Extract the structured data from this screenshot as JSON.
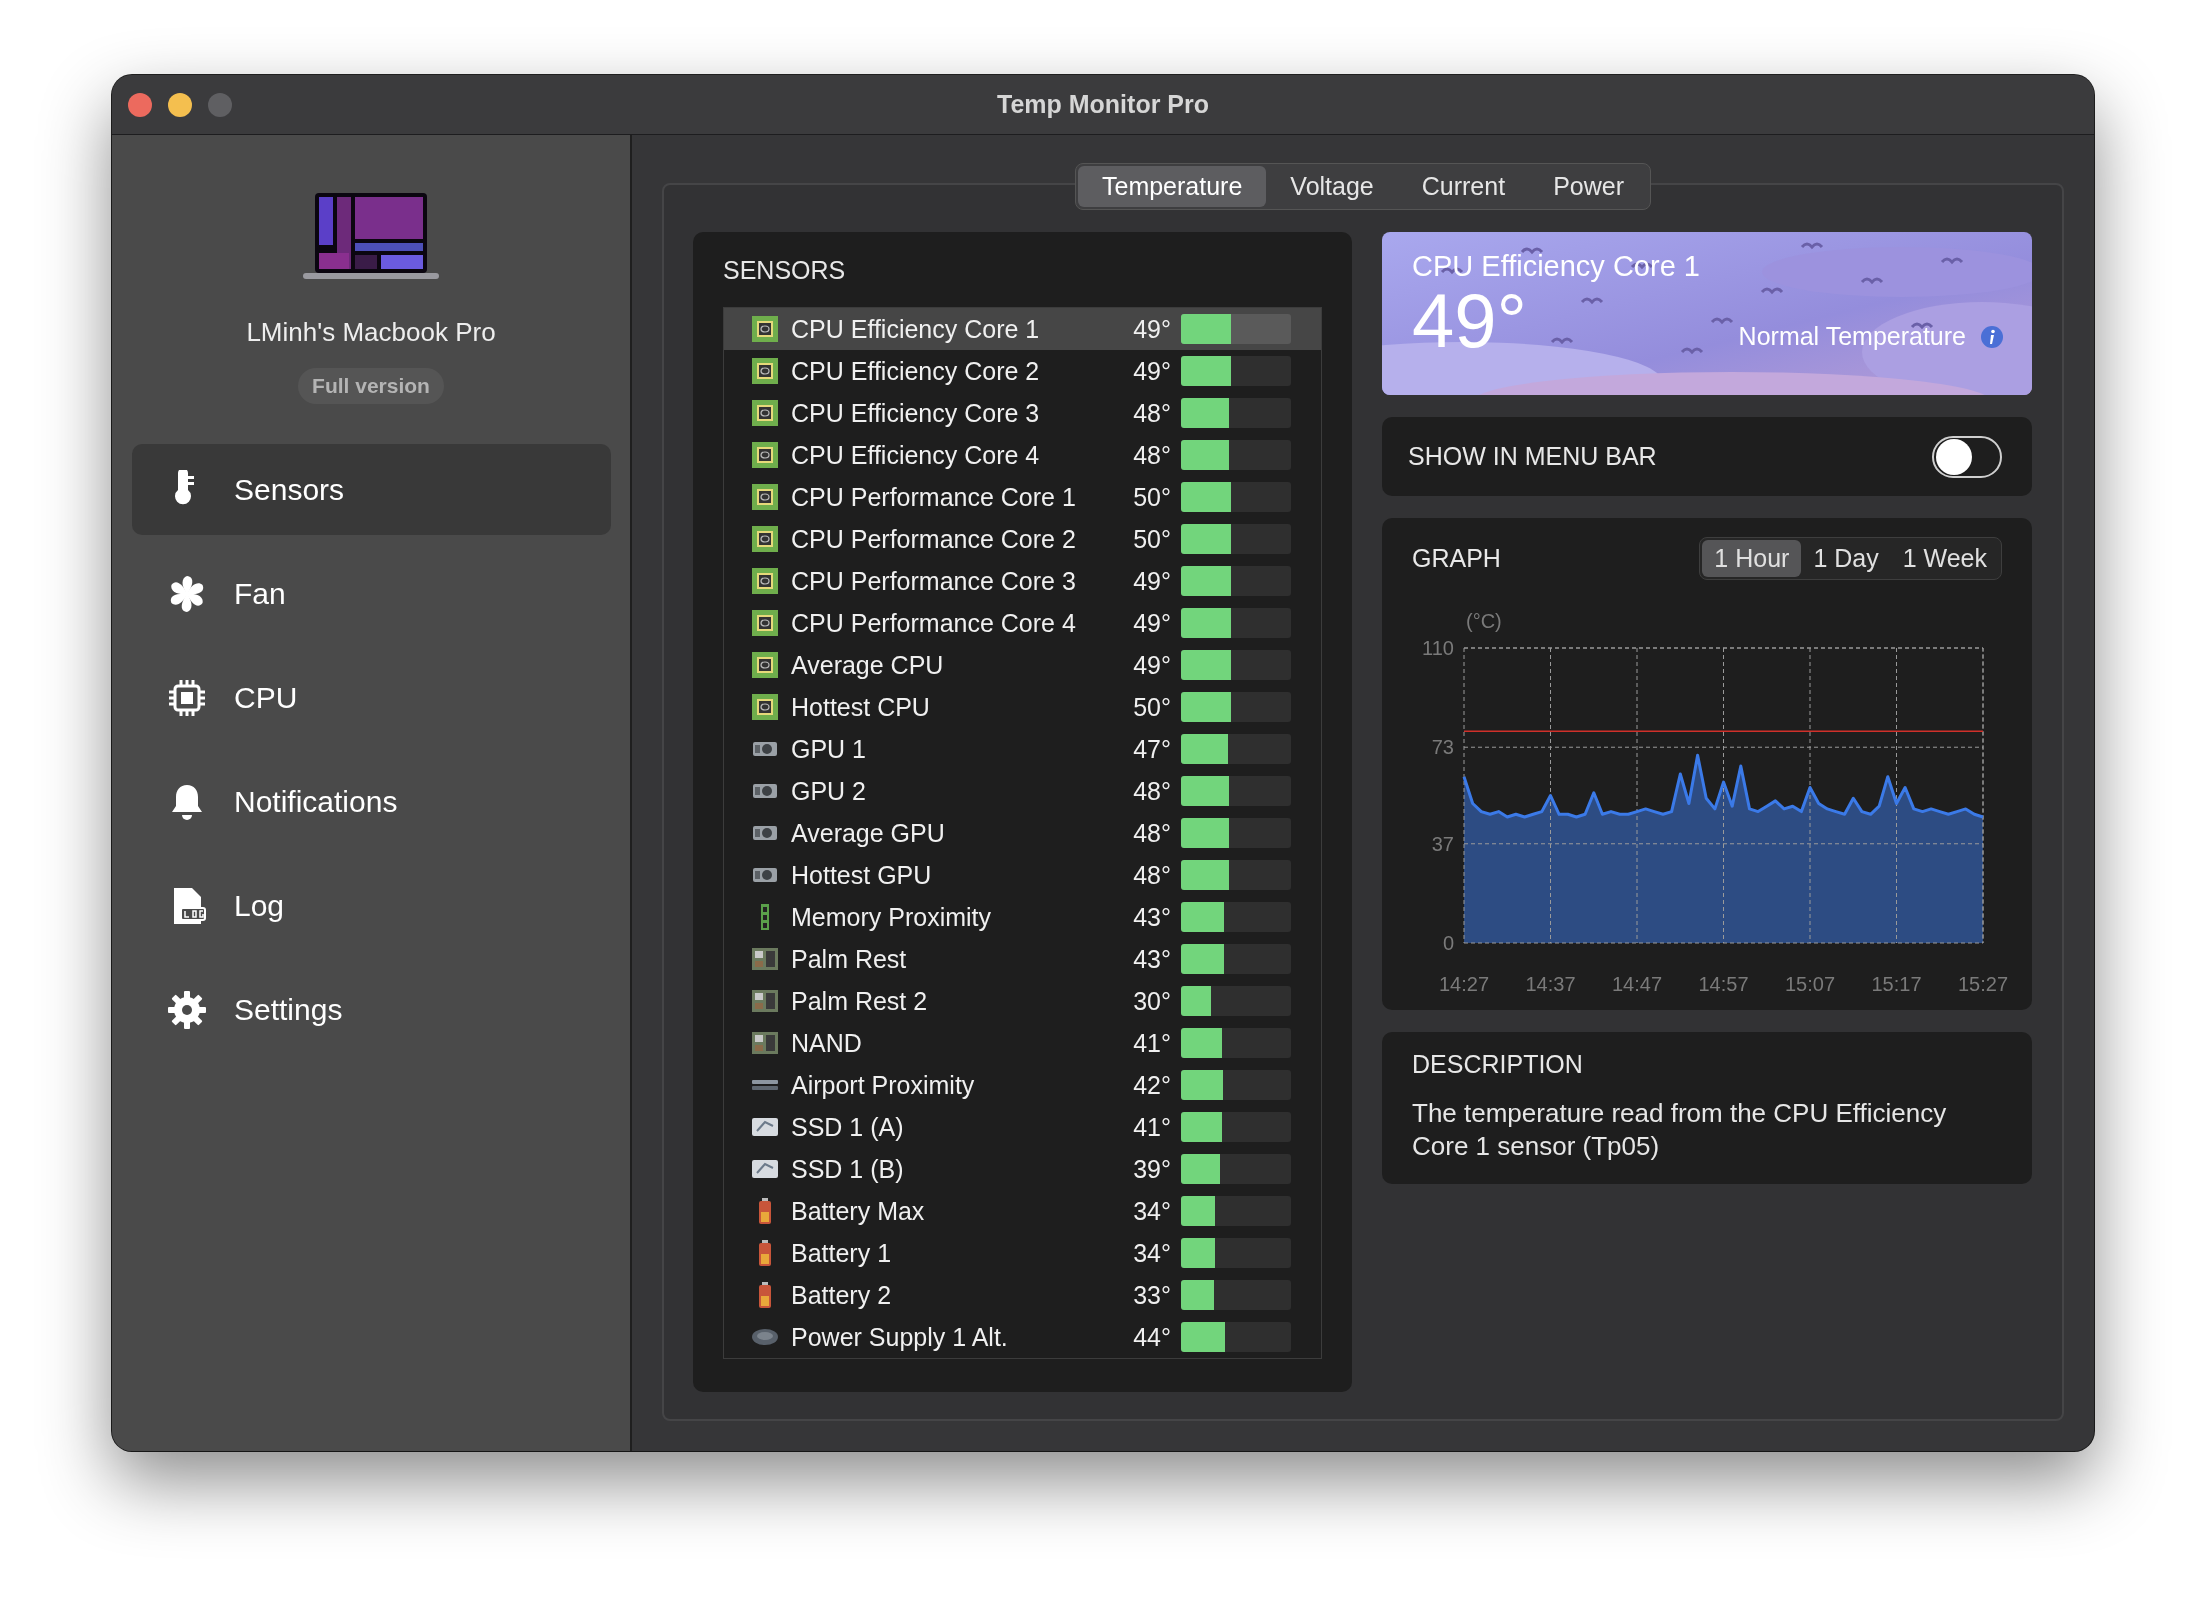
{
  "window": {
    "title": "Temp Monitor Pro"
  },
  "sidebar": {
    "device_name": "LMinh's Macbook Pro",
    "badge": "Full version",
    "items": [
      {
        "label": "Sensors",
        "kind": "thermometer",
        "selected": true
      },
      {
        "label": "Fan",
        "kind": "fan",
        "selected": false
      },
      {
        "label": "CPU",
        "kind": "cpu",
        "selected": false
      },
      {
        "label": "Notifications",
        "kind": "bell",
        "selected": false
      },
      {
        "label": "Log",
        "kind": "log",
        "selected": false
      },
      {
        "label": "Settings",
        "kind": "gear",
        "selected": false
      }
    ]
  },
  "tabs": [
    {
      "label": "Temperature",
      "selected": true
    },
    {
      "label": "Voltage",
      "selected": false
    },
    {
      "label": "Current",
      "selected": false
    },
    {
      "label": "Power",
      "selected": false
    }
  ],
  "sensors": {
    "title": "SENSORS",
    "rows": [
      {
        "name": "CPU Efficiency Core 1",
        "kind": "cpu",
        "value": "49°",
        "level": 0.45,
        "selected": true
      },
      {
        "name": "CPU Efficiency Core 2",
        "kind": "cpu",
        "value": "49°",
        "level": 0.45,
        "selected": false
      },
      {
        "name": "CPU Efficiency Core 3",
        "kind": "cpu",
        "value": "48°",
        "level": 0.44,
        "selected": false
      },
      {
        "name": "CPU Efficiency Core 4",
        "kind": "cpu",
        "value": "48°",
        "level": 0.44,
        "selected": false
      },
      {
        "name": "CPU Performance Core 1",
        "kind": "cpu",
        "value": "50°",
        "level": 0.45,
        "selected": false
      },
      {
        "name": "CPU Performance Core 2",
        "kind": "cpu",
        "value": "50°",
        "level": 0.45,
        "selected": false
      },
      {
        "name": "CPU Performance Core 3",
        "kind": "cpu",
        "value": "49°",
        "level": 0.45,
        "selected": false
      },
      {
        "name": "CPU Performance Core 4",
        "kind": "cpu",
        "value": "49°",
        "level": 0.45,
        "selected": false
      },
      {
        "name": "Average CPU",
        "kind": "cpu",
        "value": "49°",
        "level": 0.45,
        "selected": false
      },
      {
        "name": "Hottest CPU",
        "kind": "cpu",
        "value": "50°",
        "level": 0.45,
        "selected": false
      },
      {
        "name": "GPU 1",
        "kind": "gpu",
        "value": "47°",
        "level": 0.43,
        "selected": false
      },
      {
        "name": "GPU 2",
        "kind": "gpu",
        "value": "48°",
        "level": 0.44,
        "selected": false
      },
      {
        "name": "Average GPU",
        "kind": "gpu",
        "value": "48°",
        "level": 0.44,
        "selected": false
      },
      {
        "name": "Hottest GPU",
        "kind": "gpu",
        "value": "48°",
        "level": 0.44,
        "selected": false
      },
      {
        "name": "Memory Proximity",
        "kind": "memory",
        "value": "43°",
        "level": 0.39,
        "selected": false
      },
      {
        "name": "Palm Rest",
        "kind": "board",
        "value": "43°",
        "level": 0.39,
        "selected": false
      },
      {
        "name": "Palm Rest 2",
        "kind": "board",
        "value": "30°",
        "level": 0.27,
        "selected": false
      },
      {
        "name": "NAND",
        "kind": "board",
        "value": "41°",
        "level": 0.37,
        "selected": false
      },
      {
        "name": "Airport Proximity",
        "kind": "airport",
        "value": "42°",
        "level": 0.38,
        "selected": false
      },
      {
        "name": "SSD 1 (A)",
        "kind": "ssd",
        "value": "41°",
        "level": 0.37,
        "selected": false
      },
      {
        "name": "SSD 1 (B)",
        "kind": "ssd",
        "value": "39°",
        "level": 0.35,
        "selected": false
      },
      {
        "name": "Battery Max",
        "kind": "battery",
        "value": "34°",
        "level": 0.31,
        "selected": false
      },
      {
        "name": "Battery 1",
        "kind": "battery",
        "value": "34°",
        "level": 0.31,
        "selected": false
      },
      {
        "name": "Battery 2",
        "kind": "battery",
        "value": "33°",
        "level": 0.3,
        "selected": false
      },
      {
        "name": "Power Supply 1 Alt.",
        "kind": "power",
        "value": "44°",
        "level": 0.4,
        "selected": false
      }
    ]
  },
  "detail": {
    "title": "CPU Efficiency Core 1",
    "value": "49°",
    "status": "Normal Temperature"
  },
  "menu_bar": {
    "label": "SHOW IN MENU BAR",
    "on": false
  },
  "graph": {
    "title": "GRAPH",
    "ranges": [
      {
        "label": "1 Hour",
        "selected": true
      },
      {
        "label": "1 Day",
        "selected": false
      },
      {
        "label": "1 Week",
        "selected": false
      }
    ],
    "chart_data": {
      "type": "area",
      "ylabel": "(°C)",
      "categories": [
        "14:27",
        null,
        null,
        null,
        null,
        null,
        null,
        null,
        null,
        null,
        "14:37",
        null,
        null,
        null,
        null,
        null,
        null,
        null,
        null,
        null,
        "14:47",
        null,
        null,
        null,
        null,
        null,
        null,
        null,
        null,
        null,
        "14:57",
        null,
        null,
        null,
        null,
        null,
        null,
        null,
        null,
        null,
        "15:07",
        null,
        null,
        null,
        null,
        null,
        null,
        null,
        null,
        null,
        "15:17",
        null,
        null,
        null,
        null,
        null,
        null,
        null,
        null,
        null,
        "15:27"
      ],
      "series": [
        {
          "color": "#3b7ae8",
          "values": [
            62,
            52,
            49,
            48,
            49,
            47,
            48,
            47,
            48,
            49,
            55,
            48,
            48,
            47,
            48,
            56,
            48,
            49,
            48,
            48,
            49,
            50,
            49,
            48,
            49,
            63,
            52,
            70,
            54,
            50,
            60,
            51,
            66,
            50,
            49,
            51,
            53,
            50,
            51,
            49,
            58,
            52,
            50,
            49,
            48,
            54,
            49,
            48,
            51,
            62,
            52,
            58,
            50,
            49,
            50,
            49,
            48,
            49,
            50,
            48,
            47
          ]
        }
      ],
      "ylim": [
        0,
        110
      ],
      "yticks": [
        0,
        37,
        73,
        110
      ],
      "grid": true,
      "ref_lines": [
        {
          "axis": "y",
          "value": 79
        }
      ]
    }
  },
  "description": {
    "title": "DESCRIPTION",
    "text": "The temperature read from the CPU Efficiency Core 1 sensor (Tp05)"
  }
}
